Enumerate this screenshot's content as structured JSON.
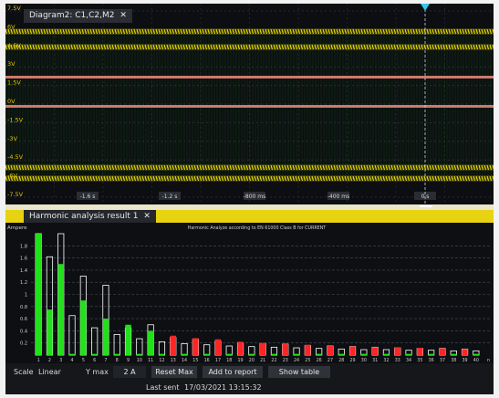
{
  "diagram_tab": {
    "label": "Diagram2: C1,C2,M2",
    "close": "✕"
  },
  "osc": {
    "y_labels": [
      "7.5V",
      "6V",
      "4.5V",
      "3V",
      "1.5V",
      "0V",
      "-1.5V",
      "-3V",
      "-4.5V",
      "-6V",
      "-7.5V"
    ],
    "x_labels": [
      "-1.6 s",
      "-1.2 s",
      "-800 ms",
      "-400 ms",
      "0 s"
    ],
    "colors": {
      "channel1": "#e6d800",
      "channel2": "#23e81b",
      "math": "#f08c7c",
      "marker": "#37c8ea"
    }
  },
  "harmonics_tab": {
    "label": "Harmonic analysis result 1",
    "close": "✕"
  },
  "harmonics": {
    "unit_label": "Ampere",
    "title": "Harmonic Analyze according to EN 61000 Class B for CURRENT",
    "y_ticks": [
      "1.8",
      "1.6",
      "1.4",
      "1.2",
      "1",
      "0.8",
      "0.6",
      "0.4",
      "0.2"
    ],
    "x_end_label": "n",
    "colors": {
      "pass": "#22e01a",
      "fail": "#ff2525",
      "limit": "#ffffff",
      "grid": "#4a4f58"
    }
  },
  "chart_data": {
    "type": "bar",
    "title": "Harmonic Analyze according to EN 61000 Class B for CURRENT",
    "ylabel": "Ampere",
    "xlabel": "n",
    "ylim": [
      0,
      2
    ],
    "categories": [
      "1",
      "2",
      "3",
      "4",
      "5",
      "6",
      "7",
      "8",
      "9",
      "10",
      "11",
      "12",
      "13",
      "14",
      "15",
      "16",
      "17",
      "18",
      "19",
      "20",
      "21",
      "22",
      "23",
      "24",
      "25",
      "26",
      "27",
      "28",
      "29",
      "30",
      "31",
      "32",
      "33",
      "34",
      "35",
      "36",
      "37",
      "38",
      "39",
      "40"
    ],
    "series": [
      {
        "values": [
          2.0,
          0.75,
          1.5,
          0.02,
          0.9,
          0.02,
          0.6,
          0.02,
          0.5,
          0.02,
          0.4,
          0.02,
          0.32,
          0.02,
          0.28,
          0.02,
          0.26,
          0.02,
          0.22,
          0.02,
          0.2,
          0.02,
          0.18,
          0.02,
          0.17,
          0.02,
          0.15,
          0.02,
          0.14,
          0.02,
          0.13,
          0.02,
          0.13,
          0.02,
          0.12,
          0.02,
          0.11,
          0.02,
          0.1,
          0.02
        ]
      },
      {
        "values": [
          2.0,
          1.62,
          2.0,
          0.65,
          1.3,
          0.45,
          1.15,
          0.34,
          0.45,
          0.27,
          0.5,
          0.22,
          0.29,
          0.19,
          0.26,
          0.17,
          0.23,
          0.15,
          0.2,
          0.14,
          0.19,
          0.13,
          0.18,
          0.12,
          0.16,
          0.11,
          0.15,
          0.1,
          0.14,
          0.09,
          0.13,
          0.09,
          0.12,
          0.08,
          0.11,
          0.08,
          0.11,
          0.07,
          0.1,
          0.07
        ]
      }
    ],
    "bar_status": [
      "pass",
      "pass",
      "pass",
      "pass",
      "pass",
      "pass",
      "pass",
      "pass",
      "pass",
      "pass",
      "pass",
      "pass",
      "fail",
      "pass",
      "fail",
      "pass",
      "fail",
      "pass",
      "fail",
      "pass",
      "fail",
      "pass",
      "fail",
      "pass",
      "fail",
      "pass",
      "fail",
      "pass",
      "fail",
      "pass",
      "fail",
      "pass",
      "fail",
      "pass",
      "fail",
      "pass",
      "fail",
      "pass",
      "fail",
      "pass"
    ]
  },
  "controls": {
    "scale_label": "Scale",
    "scale_value": "Linear",
    "ymax_label": "Y max",
    "ymax_value": "2 A",
    "reset_max": "Reset Max",
    "add_to_report": "Add to report",
    "show_table": "Show table"
  },
  "status": {
    "last_sent_label": "Last sent",
    "last_sent_value": "17/03/2021 13:15:32"
  }
}
